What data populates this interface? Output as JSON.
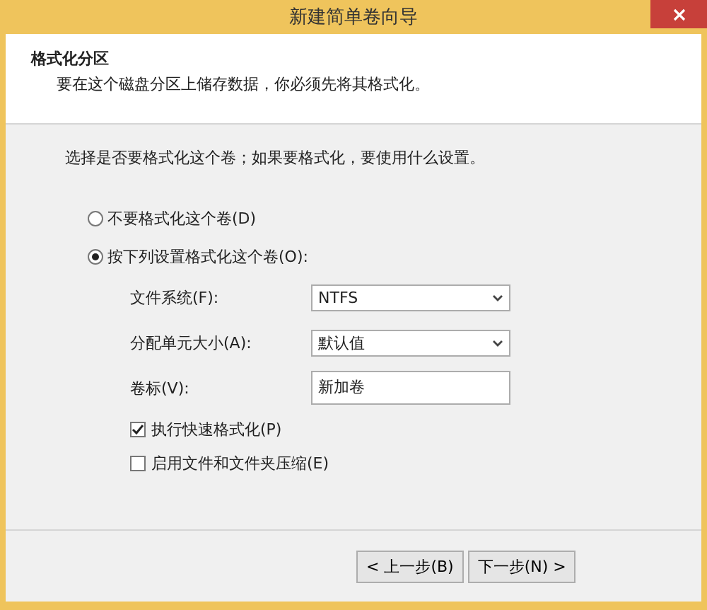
{
  "window": {
    "title": "新建简单卷向导"
  },
  "header": {
    "title": "格式化分区",
    "subtitle": "要在这个磁盘分区上储存数据，你必须先将其格式化。"
  },
  "instruction": "选择是否要格式化这个卷；如果要格式化，要使用什么设置。",
  "options": [
    {
      "label": "不要格式化这个卷(D)",
      "selected": false
    },
    {
      "label": "按下列设置格式化这个卷(O):",
      "selected": true
    }
  ],
  "fields": [
    {
      "kind": "select",
      "label": "文件系统(F):",
      "value": "NTFS"
    },
    {
      "kind": "select",
      "label": "分配单元大小(A):",
      "value": "默认值"
    },
    {
      "kind": "text",
      "label": "卷标(V):",
      "value": "新加卷"
    }
  ],
  "checkboxes": [
    {
      "label": "执行快速格式化(P)",
      "checked": true
    },
    {
      "label": "启用文件和文件夹压缩(E)",
      "checked": false
    }
  ],
  "buttons": [
    "< 上一步(B)",
    "下一步(N) >"
  ]
}
